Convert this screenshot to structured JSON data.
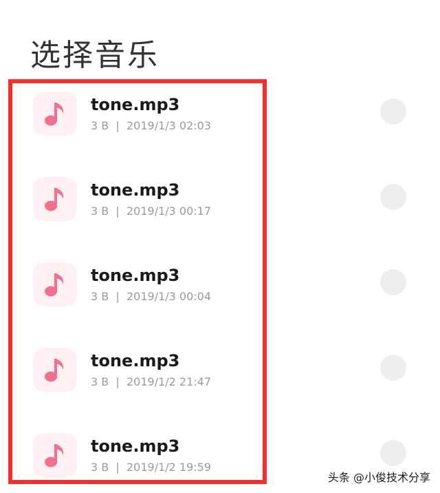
{
  "page": {
    "title": "选择音乐"
  },
  "files": [
    {
      "name": "tone.mp3",
      "size": "3 B",
      "date": "2019/1/3 02:03",
      "icon": "music-note-icon"
    },
    {
      "name": "tone.mp3",
      "size": "3 B",
      "date": "2019/1/3 00:17",
      "icon": "music-note-icon"
    },
    {
      "name": "tone.mp3",
      "size": "3 B",
      "date": "2019/1/3 00:04",
      "icon": "music-note-icon"
    },
    {
      "name": "tone.mp3",
      "size": "3 B",
      "date": "2019/1/2 21:47",
      "icon": "music-note-icon"
    },
    {
      "name": "tone.mp3",
      "size": "3 B",
      "date": "2019/1/2 19:59",
      "icon": "music-note-icon"
    }
  ],
  "meta_separator": "|",
  "watermark": "头条 @小俊技术分享",
  "colors": {
    "highlight": "#f5302b",
    "icon_tile": "#fff1f3",
    "icon_note": "#f0708e",
    "radio": "#eeeeee"
  }
}
